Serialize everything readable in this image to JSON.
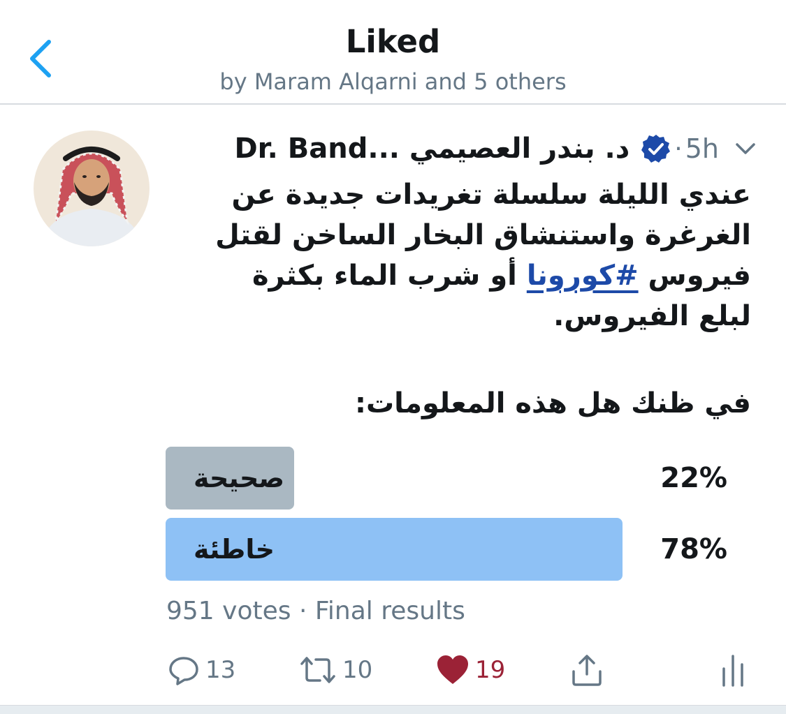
{
  "header": {
    "title": "Liked",
    "subtitle": "by Maram Alqarni and 5 others"
  },
  "tweet": {
    "author_name": "Dr. Band...  د. بندر العصيمي",
    "time_separator": "·",
    "time": "5h",
    "text_before_hashtag": "عندي الليلة سلسلة تغريدات جديدة عن الغرغرة واستنشاق البخار الساخن لقتل فيروس ",
    "hashtag": "#كورونا",
    "text_after_hashtag": " أو شرب الماء بكثرة لبلع الفيروس."
  },
  "poll": {
    "question": "في ظنك هل هذه المعلومات:",
    "options": [
      {
        "label": "صحيحة",
        "percent_text": "22%",
        "share": 0.22,
        "winner": false,
        "color": "#aab8c2"
      },
      {
        "label": "خاطئة",
        "percent_text": "78%",
        "share": 0.78,
        "winner": true,
        "color": "#8ec1f5"
      }
    ],
    "votes_text": "951 votes · Final results"
  },
  "actions": {
    "reply_count": "13",
    "retweet_count": "10",
    "like_count": "19",
    "liked": true
  },
  "icons": {
    "back": "chevron-left-icon",
    "verified": "verified-badge-icon",
    "caret": "chevron-down-icon",
    "reply": "reply-icon",
    "retweet": "retweet-icon",
    "like": "heart-icon",
    "share": "share-icon",
    "analytics": "analytics-icon"
  },
  "colors": {
    "accent": "#1da1f2",
    "verified": "#1d4aa8",
    "like": "#9b2236",
    "muted_text": "#657786",
    "winner_bar": "#8ec1f5",
    "loser_bar": "#aab8c2"
  }
}
